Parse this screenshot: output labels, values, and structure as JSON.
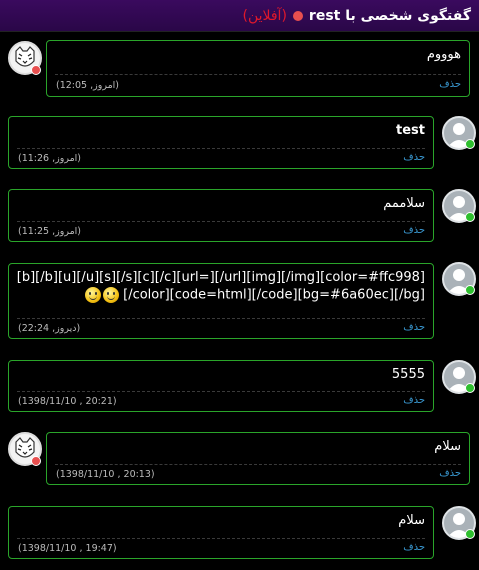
{
  "header": {
    "title": "گفتگوی شخصی با rest",
    "status": "(آفلاین)",
    "status_color": "#e0182b",
    "dot_color": "#e84f4f"
  },
  "messages": [
    {
      "side": "right",
      "avatar": "tiger-avatar",
      "badge": "offline",
      "text": "هوووم",
      "bold": false,
      "delete_label": "حذف",
      "time": "(امروز, 12:05)"
    },
    {
      "side": "left",
      "avatar": "default-avatar",
      "badge": "online",
      "text": "test",
      "bold": true,
      "delete_label": "حذف",
      "time": "(امروز, 11:26)"
    },
    {
      "side": "left",
      "avatar": "default-avatar",
      "badge": "online",
      "text": "سلاممم",
      "bold": false,
      "delete_label": "حذف",
      "time": "(امروز, 11:25)"
    },
    {
      "side": "left",
      "avatar": "default-avatar",
      "badge": "online",
      "text_line1": "[color=#ffc998][img/][img][url/][=url][c/][c][s/][s][u/][u][b/][b]",
      "text_line2": "[bg/][bg=#6a60ec][code/][code=html][color/]",
      "emoticons": [
        "smiley-icon",
        "smiley-icon"
      ],
      "delete_label": "حذف",
      "time": "(دیروز, 22:24)"
    },
    {
      "side": "left",
      "avatar": "default-avatar",
      "badge": "online",
      "text": "5555",
      "bold": false,
      "delete_label": "حذف",
      "time": "(1398/11/10 , 20:21)"
    },
    {
      "side": "right",
      "avatar": "tiger-avatar",
      "badge": "offline",
      "text": "سلام",
      "bold": false,
      "delete_label": "حذف",
      "time": "(1398/11/10 , 20:13)"
    },
    {
      "side": "left",
      "avatar": "default-avatar",
      "badge": "online",
      "text": "سلام",
      "bold": false,
      "delete_label": "حذف",
      "time": "(1398/11/10 , 19:47)"
    }
  ],
  "colors": {
    "online": "#2fbf2f",
    "offline": "#e84f4f",
    "border": "#2aa52a",
    "link": "#3a9bd5"
  }
}
